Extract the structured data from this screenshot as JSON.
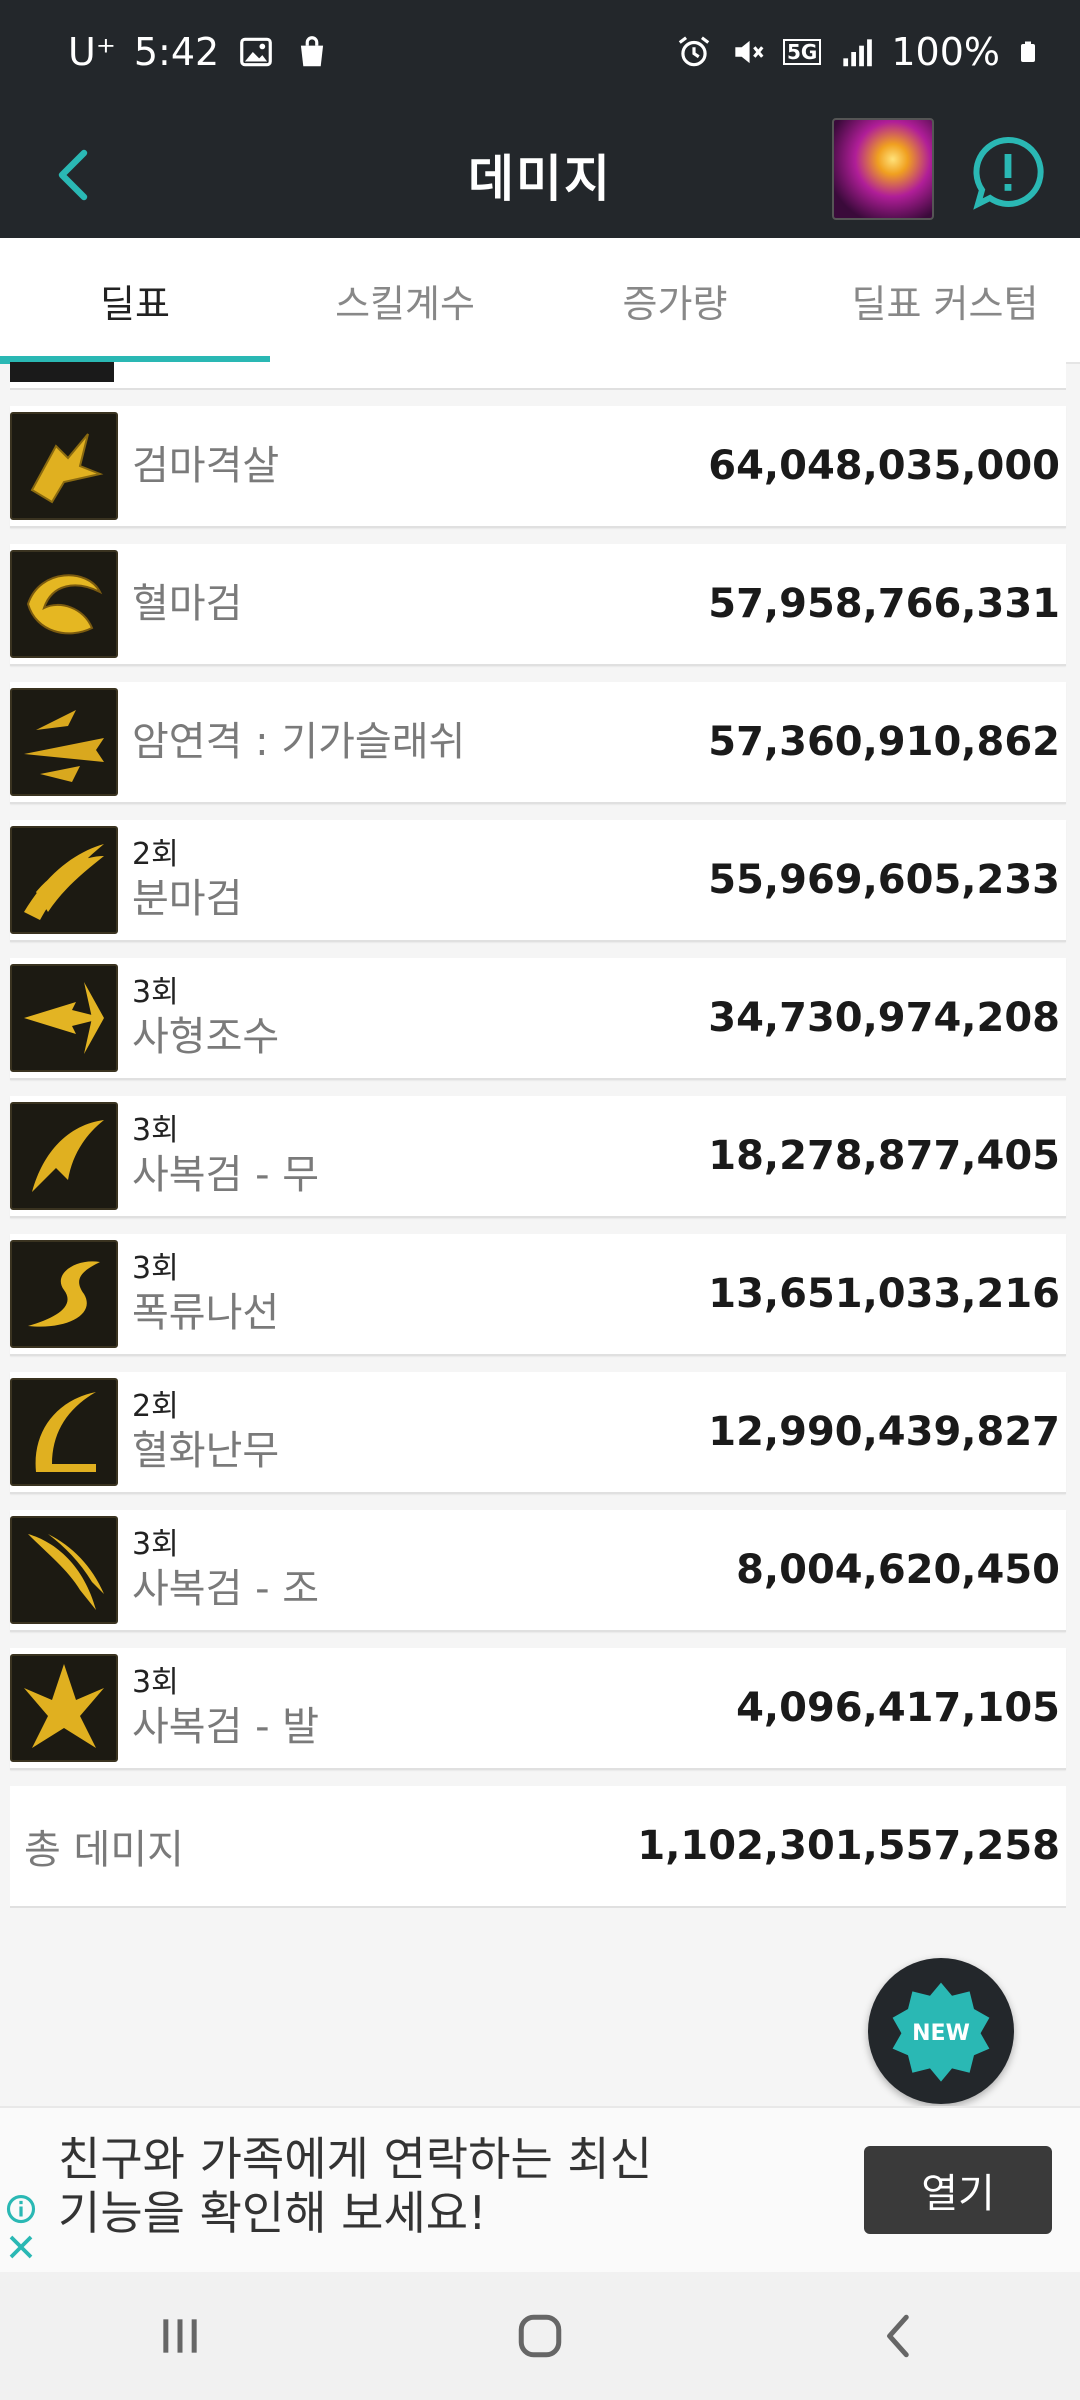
{
  "status_bar": {
    "carrier": "U⁺",
    "time": "5:42",
    "network": "5G",
    "battery": "100%",
    "icons": [
      "image-icon",
      "shopping-bag-icon",
      "alarm-icon",
      "mute-icon",
      "signal-icon",
      "battery-icon"
    ]
  },
  "header": {
    "title": "데미지",
    "back_icon": "chevron-left-icon",
    "chat_icon": "alert-chat-icon"
  },
  "tabs": [
    {
      "label": "딜표",
      "active": true
    },
    {
      "label": "스킬계수",
      "active": false
    },
    {
      "label": "증가량",
      "active": false
    },
    {
      "label": "딜표 커스텀",
      "active": false
    }
  ],
  "skills": [
    {
      "hits": "",
      "name": "검마격살",
      "damage": "64,048,035,000"
    },
    {
      "hits": "",
      "name": "혈마검",
      "damage": "57,958,766,331"
    },
    {
      "hits": "",
      "name": "암연격 : 기가슬래쉬",
      "damage": "57,360,910,862"
    },
    {
      "hits": "2회",
      "name": "분마검",
      "damage": "55,969,605,233"
    },
    {
      "hits": "3회",
      "name": "사형조수",
      "damage": "34,730,974,208"
    },
    {
      "hits": "3회",
      "name": "사복검 - 무",
      "damage": "18,278,877,405"
    },
    {
      "hits": "3회",
      "name": "폭류나선",
      "damage": "13,651,033,216"
    },
    {
      "hits": "2회",
      "name": "혈화난무",
      "damage": "12,990,439,827"
    },
    {
      "hits": "3회",
      "name": "사복검 - 조",
      "damage": "8,004,620,450"
    },
    {
      "hits": "3회",
      "name": "사복검 - 발",
      "damage": "4,096,417,105"
    }
  ],
  "total": {
    "label": "총 데미지",
    "value": "1,102,301,557,258"
  },
  "fab": {
    "label": "NEW"
  },
  "ad": {
    "line1": "친구와 가족에게 연락하는 최신",
    "line2": "기능을 확인해 보세요!",
    "button": "열기"
  },
  "colors": {
    "accent": "#2ab8b4",
    "header_bg": "#23272b",
    "icon_gold": "#e0b020"
  }
}
